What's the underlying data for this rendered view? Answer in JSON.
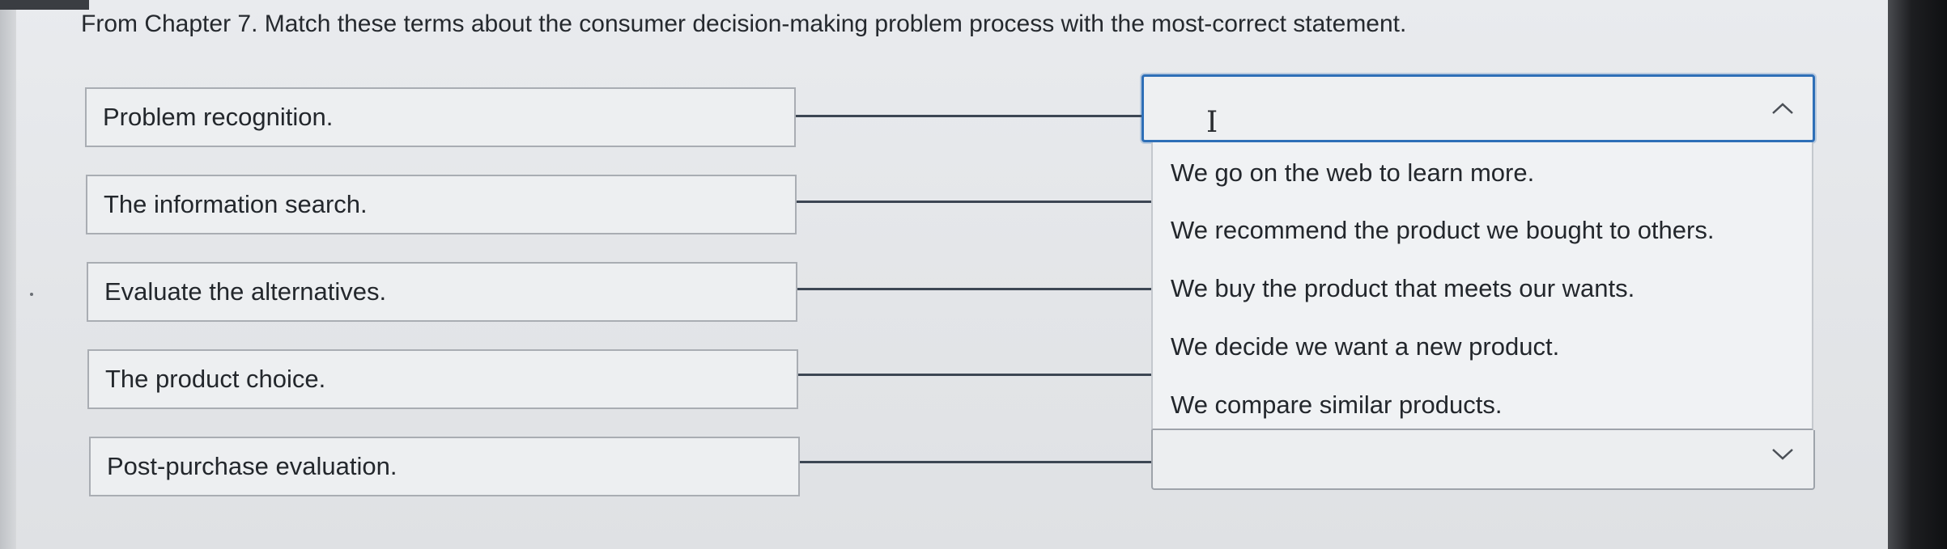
{
  "question": {
    "text": "From Chapter 7. Match these terms about the consumer decision-making problem process with the most-correct statement."
  },
  "terms": [
    {
      "label": "Problem recognition."
    },
    {
      "label": "The information search."
    },
    {
      "label": "Evaluate the alternatives."
    },
    {
      "label": "The product choice."
    },
    {
      "label": "Post-purchase evaluation."
    }
  ],
  "dropdown": {
    "selected_value": "",
    "state": "open",
    "options": [
      {
        "label": "We go on the web to learn more."
      },
      {
        "label": "We recommend the product we bought to others."
      },
      {
        "label": "We buy the product that meets our wants."
      },
      {
        "label": "We decide we want a new product."
      },
      {
        "label": "We compare similar products."
      }
    ]
  },
  "colors": {
    "accent_border": "#2e6fb7",
    "connector": "#3c4653",
    "background": "#e6e8eb"
  },
  "icons": {
    "text_cursor": "text-cursor-icon",
    "chevron_up": "chevron-up-icon",
    "chevron_down": "chevron-down-icon"
  }
}
